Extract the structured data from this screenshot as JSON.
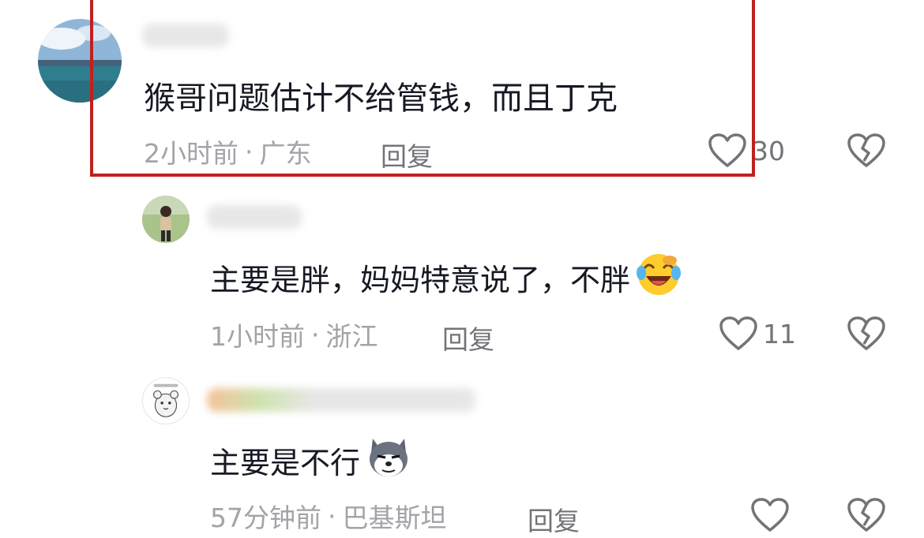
{
  "comments": [
    {
      "text": "猴哥问题估计不给管钱，而且丁克",
      "time": "2小时前",
      "sep": "·",
      "location": "广东",
      "reply_label": "回复",
      "like_count": "30",
      "avatar": "sea-landscape-avatar"
    },
    {
      "text": "主要是胖，妈妈特意说了，不胖",
      "emoji": "laughing-crying-emoji",
      "time": "1小时前",
      "sep": "·",
      "location": "浙江",
      "reply_label": "回复",
      "like_count": "11",
      "avatar": "person-photo-avatar"
    },
    {
      "text": "主要是不行",
      "emoji": "husky-dog-emoji",
      "time": "57分钟前",
      "sep": "·",
      "location": "巴基斯坦",
      "reply_label": "回复",
      "like_count": "",
      "avatar": "hamster-cartoon-avatar"
    }
  ],
  "colors": {
    "highlight_border": "#c0211d",
    "primary_text": "#161823",
    "meta_text": "#a3a3a8",
    "icon_gray": "#737378"
  }
}
